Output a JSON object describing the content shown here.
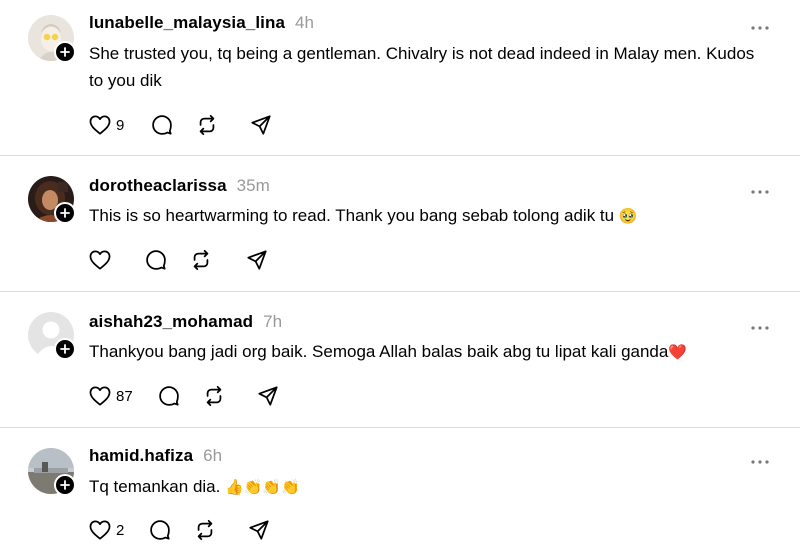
{
  "posts": [
    {
      "username": "lunabelle_malaysia_lina",
      "time": "4h",
      "text": "She trusted you, tq being a gentleman. Chivalry is not dead indeed in Malay men. Kudos to you dik",
      "likes": "9",
      "avatar": "avatar-photo-light"
    },
    {
      "username": "dorotheaclarissa",
      "time": "35m",
      "text": "This is so heartwarming to read. Thank you bang sebab tolong adik tu",
      "emoji": "🥹",
      "likes": "",
      "avatar": "avatar-photo-dark"
    },
    {
      "username": "aishah23_mohamad",
      "time": "7h",
      "text": "Thankyou bang jadi org baik. Semoga Allah balas baik abg tu lipat kali ganda",
      "emoji": "❤️",
      "likes": "87",
      "avatar": "default-avatar"
    },
    {
      "username": "hamid.hafiza",
      "time": "6h",
      "text": "Tq temankan dia. ",
      "emoji": "👍👏👏👏",
      "likes": "2",
      "avatar": "avatar-photo-landscape"
    }
  ],
  "icons": {
    "like": "heart-icon",
    "reply": "comment-bubble-icon",
    "repost": "repost-icon",
    "share": "send-icon",
    "more": "more-dots-icon",
    "follow": "plus-icon"
  },
  "colors": {
    "text": "#000000",
    "muted": "#999999",
    "divider": "#dcdcdc"
  }
}
